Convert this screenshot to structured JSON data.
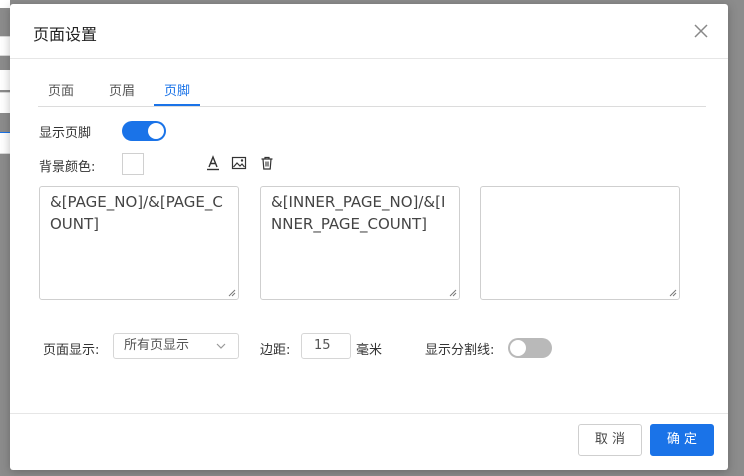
{
  "dialog": {
    "title": "页面设置"
  },
  "tabs": [
    {
      "label": "页面",
      "active": false
    },
    {
      "label": "页眉",
      "active": false
    },
    {
      "label": "页脚",
      "active": true
    }
  ],
  "footer_settings": {
    "show_footer_label": "显示页脚",
    "show_footer_enabled": true,
    "bg_color_label": "背景颜色:",
    "bg_color_value": "#ffffff",
    "tool_icons": [
      "text-color-icon",
      "image-icon",
      "trash-icon"
    ],
    "left_text": "&[PAGE_NO]/&[PAGE_COUNT]",
    "center_text": "&[INNER_PAGE_NO]/&[INNER_PAGE_COUNT]",
    "right_text": "",
    "page_display_label": "页面显示:",
    "page_display_value": "所有页显示",
    "margin_label": "边距:",
    "margin_value": "15",
    "margin_unit": "毫米",
    "divider_label": "显示分割线:",
    "divider_enabled": false
  },
  "buttons": {
    "cancel": "取 消",
    "ok": "确 定"
  },
  "colors": {
    "accent": "#1a73e8",
    "toggle_off": "#b9b9b9"
  }
}
